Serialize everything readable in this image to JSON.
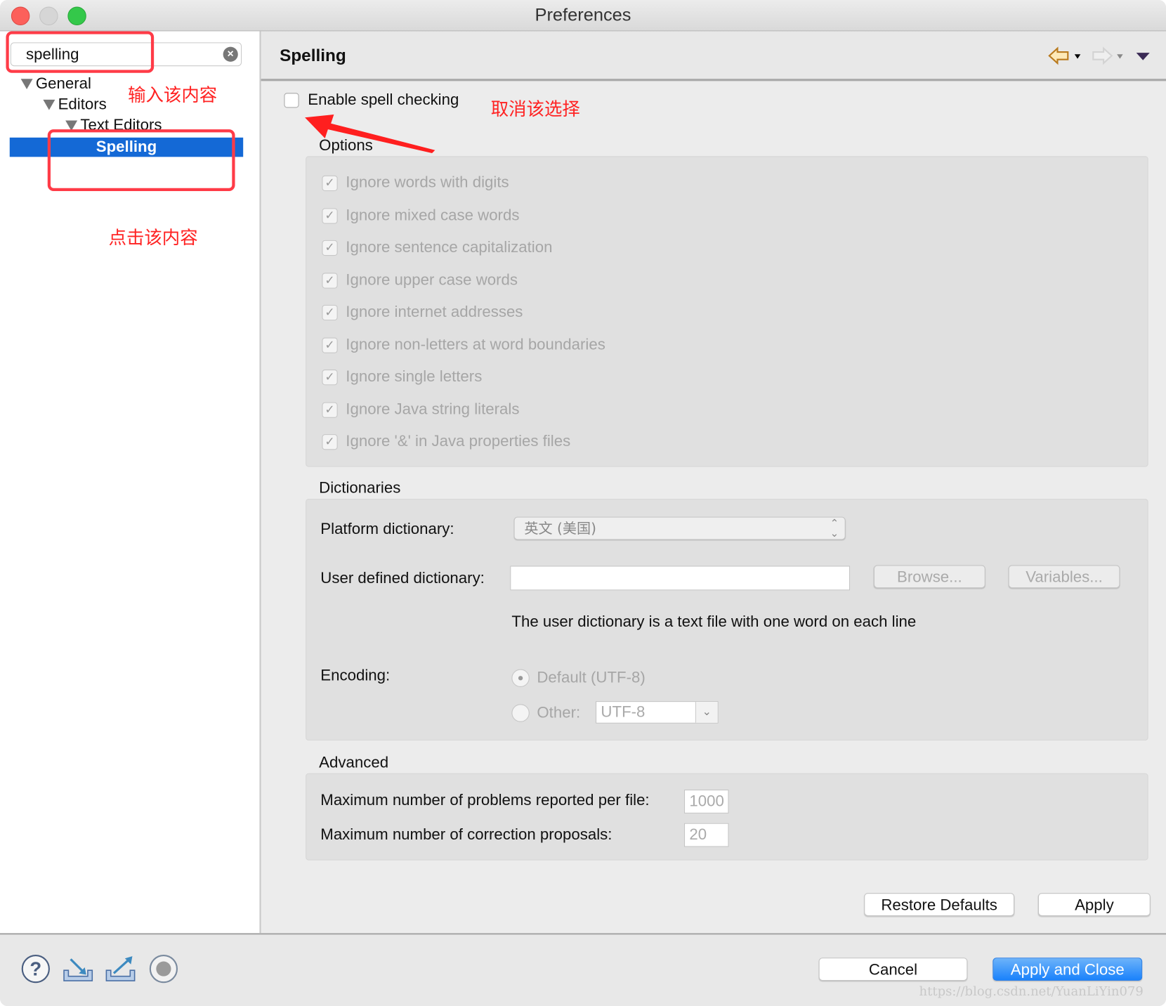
{
  "window": {
    "title": "Preferences"
  },
  "sidebar": {
    "search_value": "spelling",
    "tree": [
      {
        "label": "General",
        "expanded": true
      },
      {
        "label": "Editors",
        "expanded": true
      },
      {
        "label": "Text Editors",
        "expanded": true
      },
      {
        "label": "Spelling",
        "selected": true
      }
    ]
  },
  "annotations": {
    "type_this": "输入该内容",
    "click_this": "点击该内容",
    "uncheck_this": "取消该选择",
    "color": "#ff3b47"
  },
  "page": {
    "title": "Spelling",
    "enable_spell_checking": {
      "label": "Enable spell checking",
      "checked": false
    },
    "options": {
      "title": "Options",
      "items": [
        {
          "label": "Ignore words with digits",
          "checked": true
        },
        {
          "label": "Ignore mixed case words",
          "checked": true
        },
        {
          "label": "Ignore sentence capitalization",
          "checked": true
        },
        {
          "label": "Ignore upper case words",
          "checked": true
        },
        {
          "label": "Ignore internet addresses",
          "checked": true
        },
        {
          "label": "Ignore non-letters at word boundaries",
          "checked": true
        },
        {
          "label": "Ignore single letters",
          "checked": true
        },
        {
          "label": "Ignore Java string literals",
          "checked": true
        },
        {
          "label": "Ignore '&' in Java properties files",
          "checked": true
        }
      ]
    },
    "dictionaries": {
      "title": "Dictionaries",
      "platform_label": "Platform dictionary:",
      "platform_value": "英文 (美国)",
      "user_label": "User defined dictionary:",
      "user_value": "",
      "browse": "Browse...",
      "variables": "Variables...",
      "info": "The user dictionary is a text file with one word on each line",
      "encoding_label": "Encoding:",
      "default_radio": "Default (UTF-8)",
      "other_radio": "Other:",
      "other_value": "UTF-8"
    },
    "advanced": {
      "title": "Advanced",
      "max_problems_label": "Maximum number of problems reported per file:",
      "max_problems_value": "1000",
      "max_proposals_label": "Maximum number of correction proposals:",
      "max_proposals_value": "20"
    },
    "restore_defaults": "Restore Defaults",
    "apply": "Apply"
  },
  "footer": {
    "cancel": "Cancel",
    "apply_and_close": "Apply and Close",
    "watermark": "https://blog.csdn.net/YuanLiYin079",
    "accent": "#1a82fb"
  }
}
